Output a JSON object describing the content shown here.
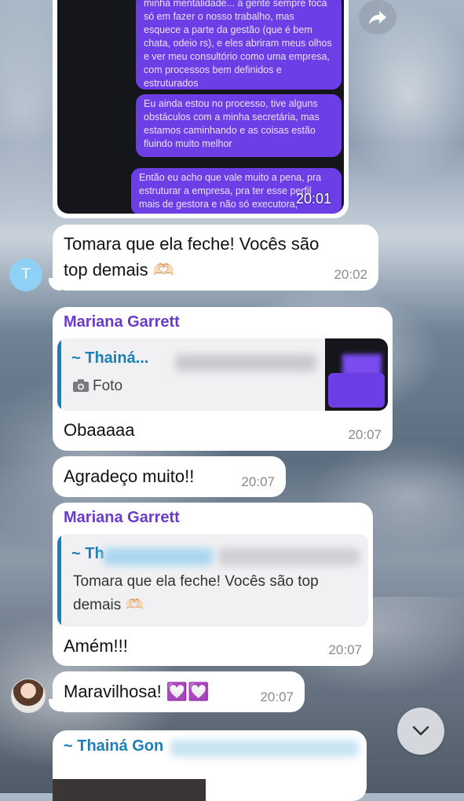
{
  "image_message": {
    "bubbles": [
      "minha mentalidade... a gente sempre foca só em fazer o nosso trabalho, mas esquece a parte da gestão (que é bem chata, odeio rs), e eles abriram meus olhos e ver meu consultório como uma empresa, com processos bem definidos e estruturados",
      "Eu ainda estou no processo, tive alguns obstáculos com a minha secretária, mas estamos caminhando e as coisas estão fluindo muito melhor",
      "Então eu acho que vale muito a pena, pra estruturar a empresa, pra ter esse perfil mais de gestora e não só executora,"
    ],
    "time": "20:01"
  },
  "msg1": {
    "avatar_letter": "T",
    "text_line1": "Tomara que ela feche! Vocês são",
    "text_line2": "top demais 🫶🏻",
    "time": "20:02"
  },
  "msg2": {
    "sender": "Mariana Garrett",
    "reply_name": "~ Thainá...",
    "reply_photo_label": "Foto",
    "text": "Obaaaaa",
    "time": "20:07"
  },
  "msg3": {
    "text": "Agradeço muito!!",
    "time": "20:07"
  },
  "msg4": {
    "sender": "Mariana Garrett",
    "reply_name": "~ Th",
    "reply_text_line1": "Tomara que ela feche! Vocês são top",
    "reply_text_line2": "demais 🫶🏻",
    "text": "Amém!!!",
    "time": "20:07"
  },
  "msg5": {
    "text": "Maravilhosa! 💟💟",
    "time": "20:07"
  },
  "msg6": {
    "sender": "~ Thainá Gon"
  }
}
